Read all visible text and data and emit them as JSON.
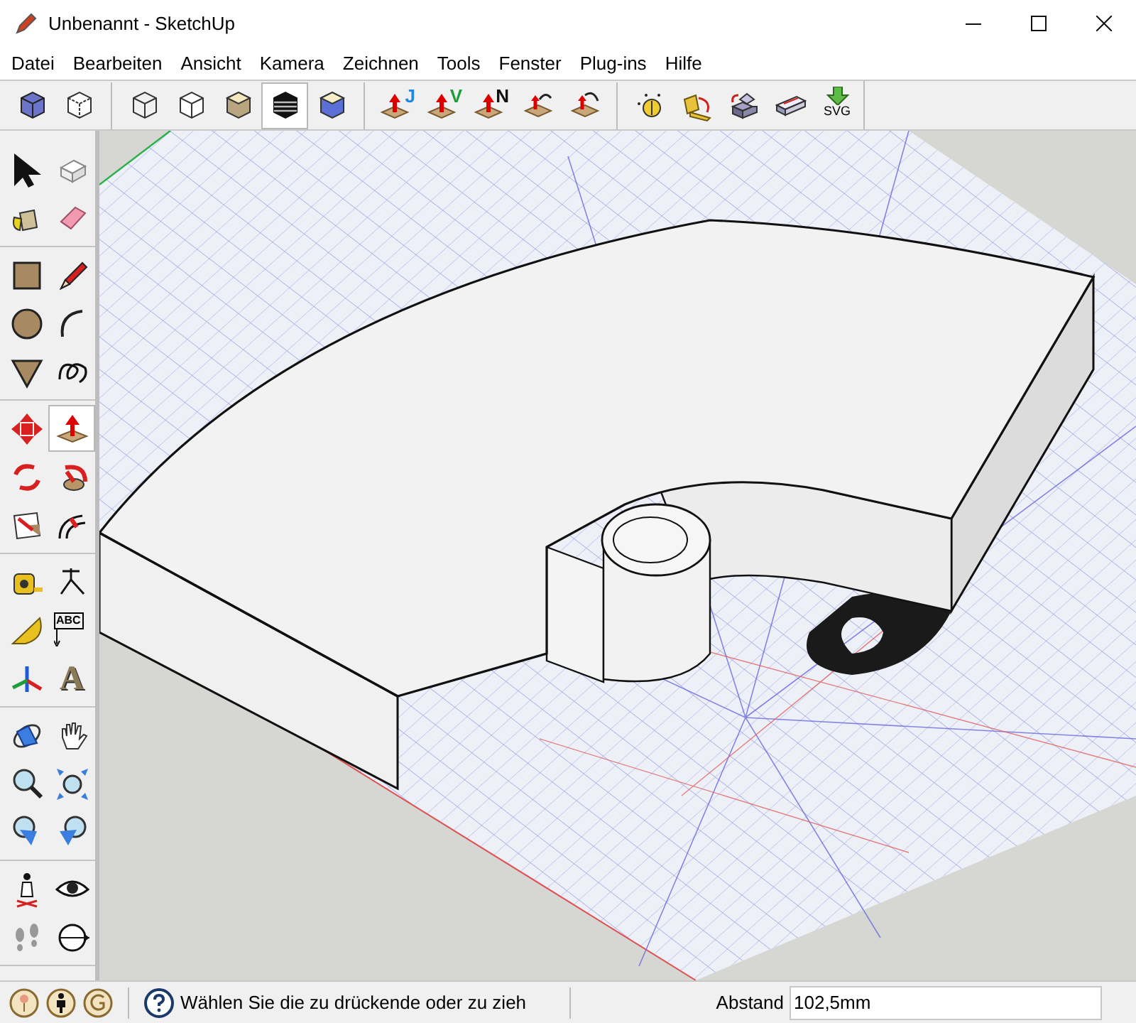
{
  "window": {
    "title": "Unbenannt - SketchUp"
  },
  "menu": [
    "Datei",
    "Bearbeiten",
    "Ansicht",
    "Kamera",
    "Zeichnen",
    "Tools",
    "Fenster",
    "Plug-ins",
    "Hilfe"
  ],
  "toolbar": {
    "groups": [
      [
        {
          "kind": "cube-xray",
          "selected": false
        },
        {
          "kind": "cube-back",
          "selected": false
        }
      ],
      [
        {
          "kind": "cube-wire",
          "selected": false
        },
        {
          "kind": "cube-hidden",
          "selected": false
        },
        {
          "kind": "cube-shaded",
          "selected": false
        },
        {
          "kind": "cube-mono",
          "selected": true
        },
        {
          "kind": "cube-color",
          "selected": false
        }
      ],
      [
        {
          "kind": "pushpull",
          "glyph": "J",
          "color": "#1e88e5",
          "selected": false
        },
        {
          "kind": "pushpull",
          "glyph": "V",
          "color": "#1f9d3a",
          "selected": false
        },
        {
          "kind": "pushpull",
          "glyph": "N",
          "color": "#111111",
          "selected": false
        },
        {
          "kind": "pull-ccw",
          "selected": false
        },
        {
          "kind": "pull-cw",
          "selected": false
        }
      ],
      [
        {
          "kind": "dial",
          "selected": false
        },
        {
          "kind": "fold",
          "selected": false
        },
        {
          "kind": "blocks",
          "selected": false
        },
        {
          "kind": "slab",
          "selected": false
        },
        {
          "kind": "download",
          "glyph": "SVG",
          "selected": false
        }
      ]
    ]
  },
  "tool_palette": {
    "groups": [
      [
        {
          "kind": "select",
          "selected": false
        },
        {
          "kind": "component",
          "selected": false
        },
        {
          "kind": "bucket",
          "selected": false
        },
        {
          "kind": "eraser",
          "selected": false
        }
      ],
      [
        {
          "kind": "rectangle",
          "selected": false
        },
        {
          "kind": "pencil",
          "selected": false
        },
        {
          "kind": "circle",
          "selected": false
        },
        {
          "kind": "arc",
          "selected": false
        },
        {
          "kind": "polygon",
          "selected": false
        },
        {
          "kind": "freehand",
          "selected": false
        }
      ],
      [
        {
          "kind": "move",
          "selected": false
        },
        {
          "kind": "pushpull-tool",
          "selected": true
        },
        {
          "kind": "rotate",
          "selected": false
        },
        {
          "kind": "followme",
          "selected": false
        },
        {
          "kind": "scale",
          "selected": false
        },
        {
          "kind": "offset",
          "selected": false
        }
      ],
      [
        {
          "kind": "tape",
          "selected": false
        },
        {
          "kind": "dimension",
          "selected": false
        },
        {
          "kind": "protractor",
          "selected": false
        },
        {
          "kind": "label",
          "glyph": "ABC",
          "selected": false
        },
        {
          "kind": "axes",
          "selected": false
        },
        {
          "kind": "text3d",
          "glyph": "A",
          "selected": false
        }
      ],
      [
        {
          "kind": "orbit",
          "selected": false
        },
        {
          "kind": "pan",
          "selected": false
        },
        {
          "kind": "zoom",
          "selected": false
        },
        {
          "kind": "zoom-extents",
          "selected": false
        },
        {
          "kind": "zoom-window",
          "selected": false
        },
        {
          "kind": "zoom-previous",
          "selected": false
        }
      ],
      [
        {
          "kind": "walk",
          "selected": false
        },
        {
          "kind": "eye",
          "selected": false
        },
        {
          "kind": "footprints",
          "selected": false
        },
        {
          "kind": "compass",
          "selected": false
        }
      ]
    ]
  },
  "status_bar": {
    "message": "Wählen Sie die zu drückende oder zu zieh",
    "measure_label": "Abstand",
    "measure_value": "102,5mm"
  }
}
